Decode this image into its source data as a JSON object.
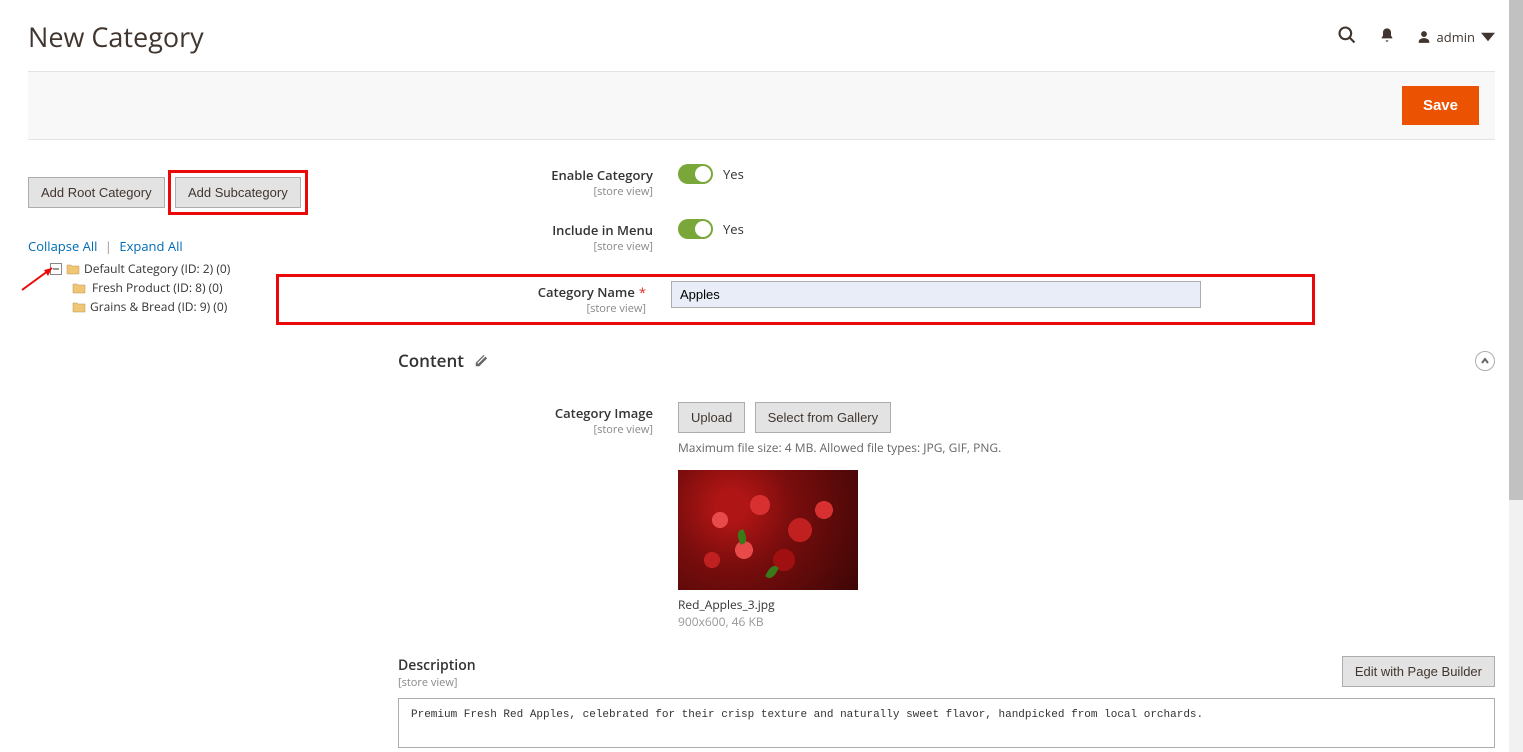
{
  "header": {
    "title": "New Category",
    "user": "admin",
    "save": "Save"
  },
  "sidebar": {
    "addRoot": "Add Root Category",
    "addSub": "Add Subcategory",
    "collapseAll": "Collapse All",
    "expandAll": "Expand All",
    "tree": [
      {
        "label": "Default Category (ID: 2) (0)",
        "indent": 1
      },
      {
        "label": "Fresh Product (ID: 8) (0)",
        "indent": 2,
        "selected": true
      },
      {
        "label": "Grains & Bread (ID: 9) (0)",
        "indent": 2
      }
    ]
  },
  "form": {
    "enable": {
      "label": "Enable Category",
      "scope": "[store view]",
      "value": "Yes"
    },
    "menu": {
      "label": "Include in Menu",
      "scope": "[store view]",
      "value": "Yes"
    },
    "name": {
      "label": "Category Name",
      "scope": "[store view]",
      "value": "Apples"
    }
  },
  "content": {
    "section": "Content",
    "image": {
      "label": "Category Image",
      "scope": "[store view]",
      "upload": "Upload",
      "gallery": "Select from Gallery",
      "hint": "Maximum file size: 4 MB. Allowed file types: JPG, GIF, PNG.",
      "filename": "Red_Apples_3.jpg",
      "filesize": "900x600, 46 KB"
    },
    "description": {
      "label": "Description",
      "scope": "[store view]",
      "editBtn": "Edit with Page Builder",
      "text": "Premium Fresh Red Apples, celebrated for their crisp texture and naturally sweet flavor, handpicked from local orchards."
    }
  }
}
